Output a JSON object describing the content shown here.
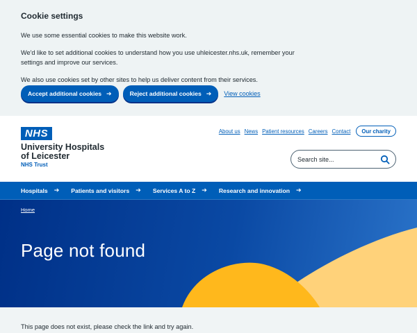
{
  "cookie_banner": {
    "title": "Cookie settings",
    "paragraphs": [
      "We use some essential cookies to make this website work.",
      "We'd like to set additional cookies to understand how you use uhleicester.nhs.uk, remember your settings and improve our services.",
      "We also use cookies set by other sites to help us deliver content from their services."
    ],
    "accept_label": "Accept additional cookies",
    "reject_label": "Reject additional cookies",
    "view_label": "View cookies"
  },
  "header": {
    "logo_text": "NHS",
    "org_line1": "University Hospitals",
    "org_line2": "of Leicester",
    "org_trust": "NHS Trust",
    "top_links": [
      "About us",
      "News",
      "Patient resources",
      "Careers",
      "Contact"
    ],
    "charity_label": "Our charity",
    "search_placeholder": "Search site..."
  },
  "nav": {
    "items": [
      "Hospitals",
      "Patients and visitors",
      "Services A to Z",
      "Research and innovation"
    ]
  },
  "hero": {
    "breadcrumb": "Home",
    "title": "Page not found"
  },
  "content": {
    "message": "This page does not exist, please check the link and try again."
  },
  "colors": {
    "nhs_blue": "#005eb8",
    "dark_blue": "#003087",
    "warm_yellow": "#ffb81c",
    "banner_bg": "#eef3f4"
  }
}
